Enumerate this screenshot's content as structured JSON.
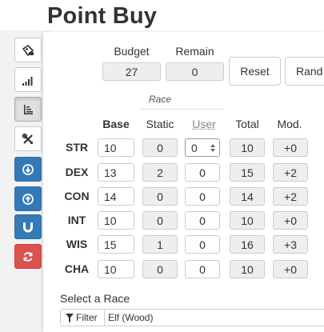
{
  "page_title": "Point Buy",
  "sidebar": [
    {
      "name": "tag-icon-button",
      "style": "default"
    },
    {
      "name": "signal-bars-icon-button",
      "style": "default"
    },
    {
      "name": "sort-list-icon-button",
      "style": "active"
    },
    {
      "name": "tools-icon-button",
      "style": "default"
    },
    {
      "name": "download-icon-button",
      "style": "blue"
    },
    {
      "name": "upload-icon-button",
      "style": "blue"
    },
    {
      "name": "magnet-icon-button",
      "style": "blue"
    },
    {
      "name": "refresh-icon-button",
      "style": "red"
    }
  ],
  "budget": {
    "label": "Budget",
    "value": "27"
  },
  "remain": {
    "label": "Remain",
    "value": "0"
  },
  "buttons": {
    "reset": "Reset",
    "random": "Rand"
  },
  "table": {
    "race_group_label": "Race",
    "headers": {
      "base": "Base",
      "static": "Static",
      "user": "User",
      "total": "Total",
      "mod": "Mod."
    },
    "rows": [
      {
        "stat": "STR",
        "base": "10",
        "static": "0",
        "user": "0",
        "total": "10",
        "mod": "+0"
      },
      {
        "stat": "DEX",
        "base": "13",
        "static": "2",
        "user": "0",
        "total": "15",
        "mod": "+2"
      },
      {
        "stat": "CON",
        "base": "14",
        "static": "0",
        "user": "0",
        "total": "14",
        "mod": "+2"
      },
      {
        "stat": "INT",
        "base": "10",
        "static": "0",
        "user": "0",
        "total": "10",
        "mod": "+0"
      },
      {
        "stat": "WIS",
        "base": "15",
        "static": "1",
        "user": "0",
        "total": "16",
        "mod": "+3"
      },
      {
        "stat": "CHA",
        "base": "10",
        "static": "0",
        "user": "0",
        "total": "10",
        "mod": "+0"
      }
    ]
  },
  "race_select": {
    "label": "Select a Race",
    "filter_label": "Filter",
    "value": "Elf (Wood)"
  }
}
